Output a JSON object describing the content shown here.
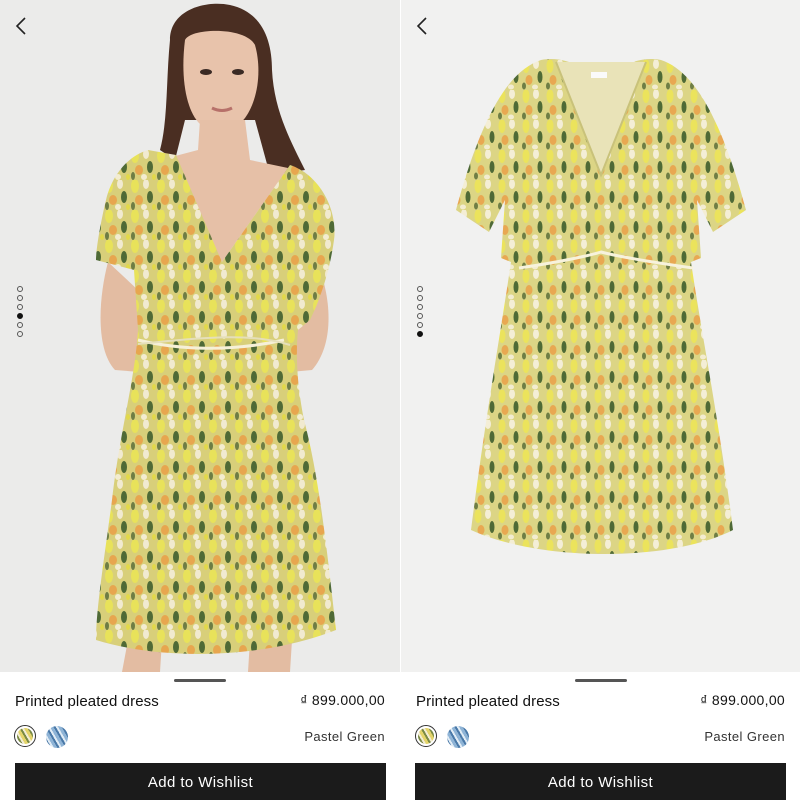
{
  "panels": [
    {
      "product_name": "Printed pleated dress",
      "price": "₫ 899.000,00",
      "color_name": "Pastel Green",
      "cta_label": "Add to Wishlist",
      "image_count": 6,
      "active_image": 4,
      "photo": "model-wearing-dress"
    },
    {
      "product_name": "Printed pleated dress",
      "price": "₫ 899.000,00",
      "color_name": "Pastel Green",
      "cta_label": "Add to Wishlist",
      "image_count": 6,
      "active_image": 6,
      "photo": "dress-flat-lay"
    }
  ],
  "icons": {
    "back": "chevron-left-icon"
  },
  "colors": {
    "cta_background": "#1b1b1b",
    "swatch_yellow_floral": "#d9c76a",
    "swatch_blue_floral": "#8fb4d6"
  }
}
